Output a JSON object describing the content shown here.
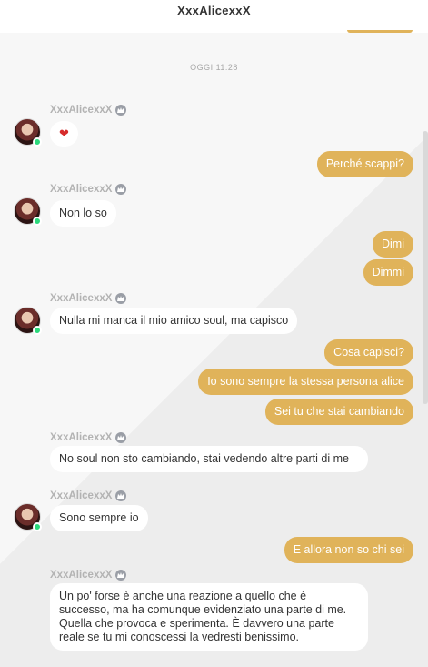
{
  "header": {
    "title": "XxxAlicexxX"
  },
  "date_separator": "OGGI 11:28",
  "icons": {
    "crown": "crown-icon",
    "heart": "heart-icon"
  },
  "colors": {
    "outgoing": "#e0b35a",
    "incoming": "#ffffff",
    "online": "#2bd97c"
  },
  "messages": [
    {
      "sender": "XxxAlicexxX",
      "text": "❤"
    },
    {
      "text": "Perché scappi?"
    },
    {
      "sender": "XxxAlicexxX",
      "text": "Non lo so"
    },
    {
      "text": "Dimi"
    },
    {
      "text": "Dimmi"
    },
    {
      "sender": "XxxAlicexxX",
      "text": "Nulla mi manca il mio amico soul, ma capisco"
    },
    {
      "text": "Cosa capisci?"
    },
    {
      "text": "Io sono sempre la stessa persona alice"
    },
    {
      "text": "Sei tu che stai cambiando"
    },
    {
      "sender": "XxxAlicexxX",
      "text": "No soul non sto cambiando, stai vedendo altre parti di me"
    },
    {
      "sender": "XxxAlicexxX",
      "text": "Sono sempre io"
    },
    {
      "text": "E allora non so chi sei"
    },
    {
      "sender": "XxxAlicexxX",
      "text": "Un po' forse è anche una reazione a quello che è successo, ma ha comunque evidenziato una parte di me. Quella che provoca e sperimenta. È davvero una parte reale se tu mi conoscessi la vedresti benissimo."
    }
  ]
}
